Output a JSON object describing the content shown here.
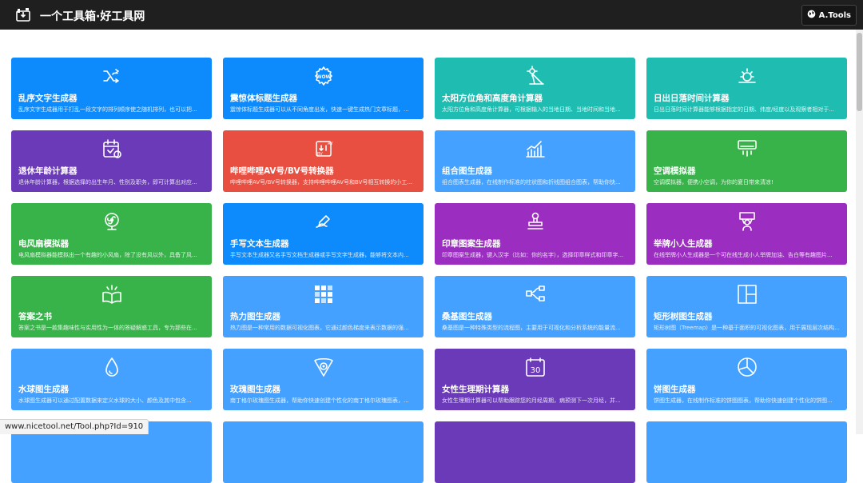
{
  "header": {
    "title": "一个工具箱·好工具网",
    "brand": "A.Tools"
  },
  "colors": {
    "blue": "#0d8afc",
    "lightblue": "#45a1ff",
    "teal": "#1fbcb2",
    "purple": "#9b2ec1",
    "violet": "#6a3ab8",
    "red": "#e94f41",
    "green": "#38b34a"
  },
  "cards": [
    {
      "title": "乱序文字生成器",
      "desc": "乱序文字生成器用于打乱一段文字的排列顺序使之随机排列，也可以把...",
      "icon": "shuffle-icon",
      "color": "blue"
    },
    {
      "title": "震惊体标题生成器",
      "desc": "震惊体标题生成器可以从不同角度出发，快速一键生成热门文章标题，...",
      "icon": "wow-icon",
      "color": "blue"
    },
    {
      "title": "太阳方位角和高度角计算器",
      "desc": "太阳方位角和高度角计算器，可根据输入的当地日期、当地时间和当地...",
      "icon": "sun-angle-icon",
      "color": "teal"
    },
    {
      "title": "日出日落时间计算器",
      "desc": "日出日落时间计算器能够根据指定的日期、纬度/经度以及观察者相对于...",
      "icon": "sunrise-icon",
      "color": "teal"
    },
    {
      "title": "退休年龄计算器",
      "desc": "退休年龄计算器，根据选择的出生年月、性别及职务，即可计算出对应...",
      "icon": "calendar-icon",
      "color": "violet"
    },
    {
      "title": "哔哩哔哩AV号/BV号转换器",
      "desc": "哔哩哔哩AV号/BV号转换器，支持哔哩哔哩AV号和BV号相互转换的小工具...",
      "icon": "av-bv-icon",
      "color": "red"
    },
    {
      "title": "组合图生成器",
      "desc": "组合图表生成器，在线制作标准的柱状图和折线图组合图表，帮助你快...",
      "icon": "combo-chart-icon",
      "color": "lightblue"
    },
    {
      "title": "空调模拟器",
      "desc": "空调模拟器，便携小空调，为你的夏日带来清凉!",
      "icon": "air-conditioner-icon",
      "color": "green"
    },
    {
      "title": "电风扇模拟器",
      "desc": "电风扇模拟器能模拟出一个有趣的小风扇，除了没有风以外，具备了风...",
      "icon": "fan-icon",
      "color": "green"
    },
    {
      "title": "手写文本生成器",
      "desc": "手写文本生成器又名手写文档生成器或手写文字生成器，能够将文本内...",
      "icon": "handwriting-icon",
      "color": "blue"
    },
    {
      "title": "印章图案生成器",
      "desc": "印章图案生成器，键入汉字（比如：你的名字），选择印章样式和印章字...",
      "icon": "stamp-icon",
      "color": "purple"
    },
    {
      "title": "举牌小人生成器",
      "desc": "在线举牌小人生成器是一个可在线生成小人举牌加油、告白等有趣图片...",
      "icon": "sign-person-icon",
      "color": "purple"
    },
    {
      "title": "答案之书",
      "desc": "答案之书是一款集趣味性与实用性为一体的答疑解惑工具，专为那些在...",
      "icon": "book-icon",
      "color": "green"
    },
    {
      "title": "热力图生成器",
      "desc": "热力图是一种常用的数据可视化图表，它通过颜色梯度来表示数据的强...",
      "icon": "heatmap-icon",
      "color": "lightblue"
    },
    {
      "title": "桑基图生成器",
      "desc": "桑基图是一种特殊类型的流程图，主要用于可视化和分析系统的能量流...",
      "icon": "sankey-icon",
      "color": "lightblue"
    },
    {
      "title": "矩形树图生成器",
      "desc": "矩形树图（Treemap）是一种基于面积的可视化图表，用于展现层次结构...",
      "icon": "treemap-icon",
      "color": "lightblue"
    },
    {
      "title": "水球图生成器",
      "desc": "水球图生成器可以通过配置数据来定义水球的大小、颜色及其中包含...",
      "icon": "water-drop-icon",
      "color": "lightblue"
    },
    {
      "title": "玫瑰图生成器",
      "desc": "南丁格尔玫瑰图生成器，帮助你快速创建个性化的南丁格尔玫瑰图表，...",
      "icon": "rose-chart-icon",
      "color": "lightblue"
    },
    {
      "title": "女性生理期计算器",
      "desc": "女性生理期计算器可以帮助跟踪您的月经周期，病预测下一次月经，并...",
      "icon": "calendar-30-icon",
      "color": "violet"
    },
    {
      "title": "饼图生成器",
      "desc": "饼图生成器，在线制作标准的饼图图表，帮助你快速创建个性化的饼图...",
      "icon": "pie-chart-icon",
      "color": "lightblue"
    },
    {
      "title": "",
      "desc": "",
      "icon": "",
      "color": "lightblue"
    },
    {
      "title": "",
      "desc": "",
      "icon": "",
      "color": "lightblue"
    },
    {
      "title": "",
      "desc": "",
      "icon": "",
      "color": "violet"
    },
    {
      "title": "",
      "desc": "",
      "icon": "",
      "color": "lightblue"
    }
  ],
  "status_url": "www.nicetool.net/Tool.php?Id=910"
}
